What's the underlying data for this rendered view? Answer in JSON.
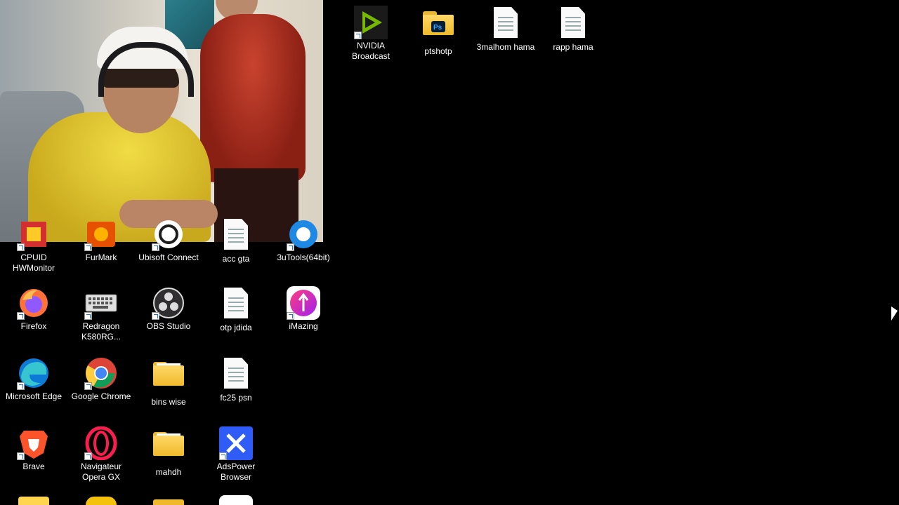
{
  "desktop": {
    "webcam_overlay": "live webcam feed overlay",
    "icons": [
      {
        "id": "nvidia-broadcast",
        "label": "NVIDIA Broadcast",
        "icon": "nvidia-broadcast-icon",
        "shortcut": true
      },
      {
        "id": "ptshotp",
        "label": "ptshotp",
        "icon": "folder-photoshop-icon",
        "shortcut": false
      },
      {
        "id": "3malhom-hama",
        "label": "3malhom hama",
        "icon": "text-file-icon",
        "shortcut": false
      },
      {
        "id": "rapp-hama",
        "label": "rapp hama",
        "icon": "text-file-icon",
        "shortcut": false
      },
      {
        "id": "cpuid-hwmonitor",
        "label": "CPUID HWMonitor",
        "icon": "hwmonitor-icon",
        "shortcut": true
      },
      {
        "id": "furmark",
        "label": "FurMark",
        "icon": "furmark-icon",
        "shortcut": true
      },
      {
        "id": "ubisoft-connect",
        "label": "Ubisoft Connect",
        "icon": "ubisoft-icon",
        "shortcut": true
      },
      {
        "id": "acc-gta",
        "label": "acc gta",
        "icon": "text-file-icon",
        "shortcut": false
      },
      {
        "id": "3utools",
        "label": "3uTools(64bit)",
        "icon": "3utools-icon",
        "shortcut": true
      },
      {
        "id": "firefox",
        "label": "Firefox",
        "icon": "firefox-icon",
        "shortcut": true
      },
      {
        "id": "redragon",
        "label": "Redragon K580RG...",
        "icon": "keyboard-icon",
        "shortcut": true
      },
      {
        "id": "obs-studio",
        "label": "OBS Studio",
        "icon": "obs-icon",
        "shortcut": true
      },
      {
        "id": "otp-jdida",
        "label": "otp jdida",
        "icon": "text-file-icon",
        "shortcut": false
      },
      {
        "id": "imazing",
        "label": "iMazing",
        "icon": "imazing-icon",
        "shortcut": true
      },
      {
        "id": "microsoft-edge",
        "label": "Microsoft Edge",
        "icon": "edge-icon",
        "shortcut": true
      },
      {
        "id": "google-chrome",
        "label": "Google Chrome",
        "icon": "chrome-icon",
        "shortcut": true
      },
      {
        "id": "bins-wise",
        "label": "bins  wise",
        "icon": "folder-icon",
        "shortcut": false
      },
      {
        "id": "fc25-psn",
        "label": "fc25 psn",
        "icon": "text-file-icon",
        "shortcut": false
      },
      {
        "id": "brave",
        "label": "Brave",
        "icon": "brave-icon",
        "shortcut": true
      },
      {
        "id": "opera-gx",
        "label": "Navigateur Opera GX",
        "icon": "opera-gx-icon",
        "shortcut": true
      },
      {
        "id": "mahdh",
        "label": "mahdh",
        "icon": "folder-icon",
        "shortcut": false
      },
      {
        "id": "adspower",
        "label": "AdsPower Browser",
        "icon": "adspower-icon",
        "shortcut": true
      }
    ]
  }
}
